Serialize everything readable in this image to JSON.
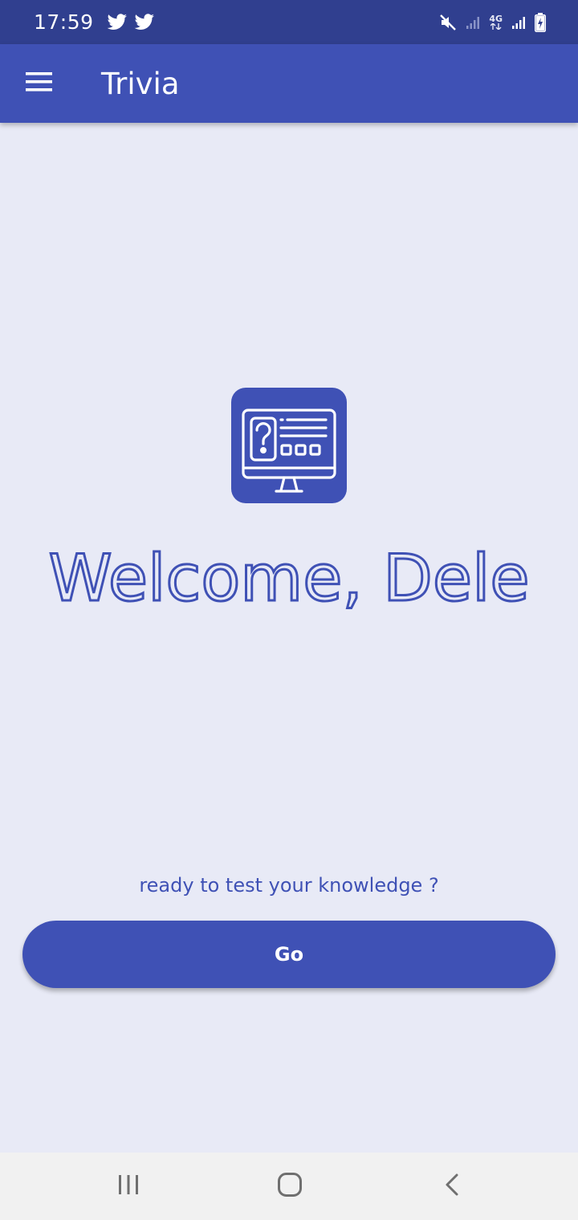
{
  "status_bar": {
    "time": "17:59",
    "notification_icons": [
      "twitter-icon",
      "twitter-icon"
    ],
    "system_icons": [
      "mute-icon",
      "signal-icon",
      "4g-icon",
      "signal-icon",
      "battery-charging-icon"
    ],
    "network_label": "4G"
  },
  "app_bar": {
    "title": "Trivia",
    "menu_icon": "hamburger-menu-icon"
  },
  "main": {
    "logo_icon": "trivia-monitor-question-icon",
    "welcome_text": "Welcome, Dele",
    "subtitle": "ready to test your knowledge ?",
    "go_button_label": "Go"
  },
  "nav_bar": {
    "buttons": [
      "recent-apps-icon",
      "home-icon",
      "back-icon"
    ]
  },
  "colors": {
    "primary": "#3f51b5",
    "primary_dark": "#303f8f",
    "background": "#e8eaf6",
    "nav_background": "#f1f1f1"
  }
}
